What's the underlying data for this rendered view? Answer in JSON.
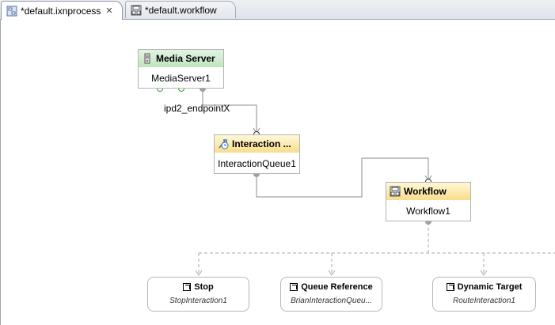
{
  "tabs": [
    {
      "label": "*default.ixnprocess",
      "close": "✕"
    },
    {
      "label": "*default.workflow"
    }
  ],
  "nodes": {
    "media_server": {
      "title": "Media Server",
      "name": "MediaServer1"
    },
    "interaction_queue": {
      "title": "Interaction ...",
      "name": "InteractionQueue1"
    },
    "workflow": {
      "title": "Workflow",
      "name": "Workflow1"
    }
  },
  "connection_label": "ipd2_endpointX",
  "targets": [
    {
      "title": "Stop",
      "name": "StopInteraction1"
    },
    {
      "title": "Queue Reference",
      "name": "BrianInteractionQueu..."
    },
    {
      "title": "Dynamic Target",
      "name": "RouteInteraction1"
    }
  ],
  "colors": {
    "media_header": "#c9ebc9",
    "queue_header": "#fbe49a",
    "workflow_header": "#fbe49a",
    "wire": "#8c8c8c",
    "port_green": "#2e9a2e"
  }
}
